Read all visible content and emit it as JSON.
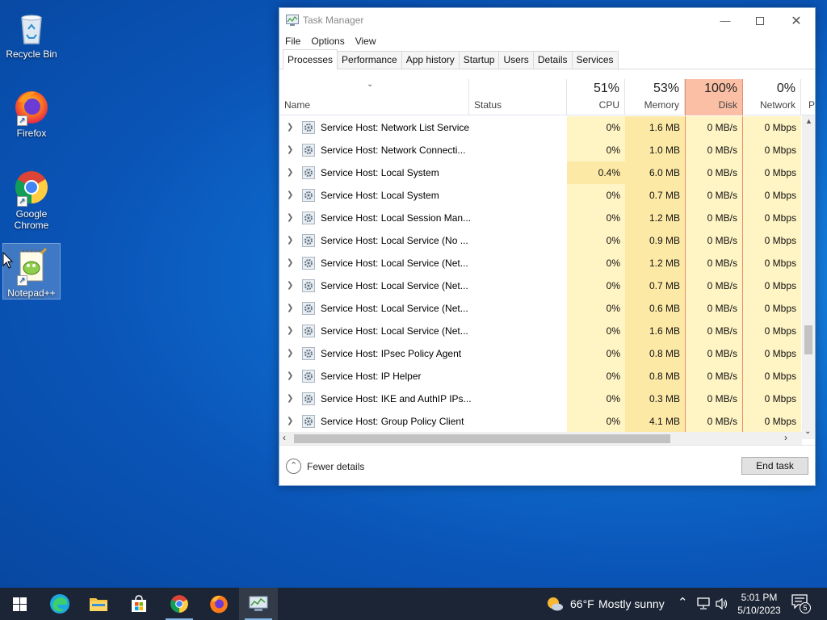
{
  "desktop": {
    "icons": [
      {
        "label": "Recycle Bin",
        "icon": "recycle-bin-icon"
      },
      {
        "label": "Firefox",
        "icon": "firefox-icon"
      },
      {
        "label": "Google Chrome",
        "icon": "chrome-icon"
      },
      {
        "label": "Notepad++",
        "icon": "notepadpp-icon"
      }
    ]
  },
  "task_manager": {
    "title": "Task Manager",
    "menu": [
      "File",
      "Options",
      "View"
    ],
    "tabs": [
      "Processes",
      "Performance",
      "App history",
      "Startup",
      "Users",
      "Details",
      "Services"
    ],
    "active_tab": "Processes",
    "columns": {
      "name": "Name",
      "status": "Status",
      "cpu": {
        "percent": "51%",
        "label": "CPU"
      },
      "memory": {
        "percent": "53%",
        "label": "Memory"
      },
      "disk": {
        "percent": "100%",
        "label": "Disk"
      },
      "network": {
        "percent": "0%",
        "label": "Network"
      },
      "overflow": "P"
    },
    "rows": [
      {
        "name": "Service Host: Network List Service",
        "cpu": "0%",
        "memory": "1.6 MB",
        "disk": "0 MB/s",
        "network": "0 Mbps"
      },
      {
        "name": "Service Host: Network Connecti...",
        "cpu": "0%",
        "memory": "1.0 MB",
        "disk": "0 MB/s",
        "network": "0 Mbps"
      },
      {
        "name": "Service Host: Local System",
        "cpu": "0.4%",
        "memory": "6.0 MB",
        "disk": "0 MB/s",
        "network": "0 Mbps"
      },
      {
        "name": "Service Host: Local System",
        "cpu": "0%",
        "memory": "0.7 MB",
        "disk": "0 MB/s",
        "network": "0 Mbps"
      },
      {
        "name": "Service Host: Local Session Man...",
        "cpu": "0%",
        "memory": "1.2 MB",
        "disk": "0 MB/s",
        "network": "0 Mbps"
      },
      {
        "name": "Service Host: Local Service (No ...",
        "cpu": "0%",
        "memory": "0.9 MB",
        "disk": "0 MB/s",
        "network": "0 Mbps"
      },
      {
        "name": "Service Host: Local Service (Net...",
        "cpu": "0%",
        "memory": "1.2 MB",
        "disk": "0 MB/s",
        "network": "0 Mbps"
      },
      {
        "name": "Service Host: Local Service (Net...",
        "cpu": "0%",
        "memory": "0.7 MB",
        "disk": "0 MB/s",
        "network": "0 Mbps"
      },
      {
        "name": "Service Host: Local Service (Net...",
        "cpu": "0%",
        "memory": "0.6 MB",
        "disk": "0 MB/s",
        "network": "0 Mbps"
      },
      {
        "name": "Service Host: Local Service (Net...",
        "cpu": "0%",
        "memory": "1.6 MB",
        "disk": "0 MB/s",
        "network": "0 Mbps"
      },
      {
        "name": "Service Host: IPsec Policy Agent",
        "cpu": "0%",
        "memory": "0.8 MB",
        "disk": "0 MB/s",
        "network": "0 Mbps"
      },
      {
        "name": "Service Host: IP Helper",
        "cpu": "0%",
        "memory": "0.8 MB",
        "disk": "0 MB/s",
        "network": "0 Mbps"
      },
      {
        "name": "Service Host: IKE and AuthIP IPs...",
        "cpu": "0%",
        "memory": "0.3 MB",
        "disk": "0 MB/s",
        "network": "0 Mbps"
      },
      {
        "name": "Service Host: Group Policy Client",
        "cpu": "0%",
        "memory": "4.1 MB",
        "disk": "0 MB/s",
        "network": "0 Mbps"
      }
    ],
    "footer": {
      "fewer_details": "Fewer details",
      "end_task": "End task"
    }
  },
  "taskbar": {
    "apps": [
      "start-icon",
      "edge-icon",
      "file-explorer-icon",
      "store-icon",
      "chrome-icon",
      "firefox-icon",
      "task-manager-icon"
    ],
    "weather": {
      "temp": "66°F",
      "condition": "Mostly sunny"
    },
    "clock": {
      "time": "5:01 PM",
      "date": "5/10/2023"
    },
    "notifications": "5"
  },
  "colors": {
    "cpu_heat_low": "#fff4c4",
    "cpu_heat_mid": "#fde9a6",
    "disk_header": "#fbbfa5",
    "taskbar": "#1c2535"
  }
}
